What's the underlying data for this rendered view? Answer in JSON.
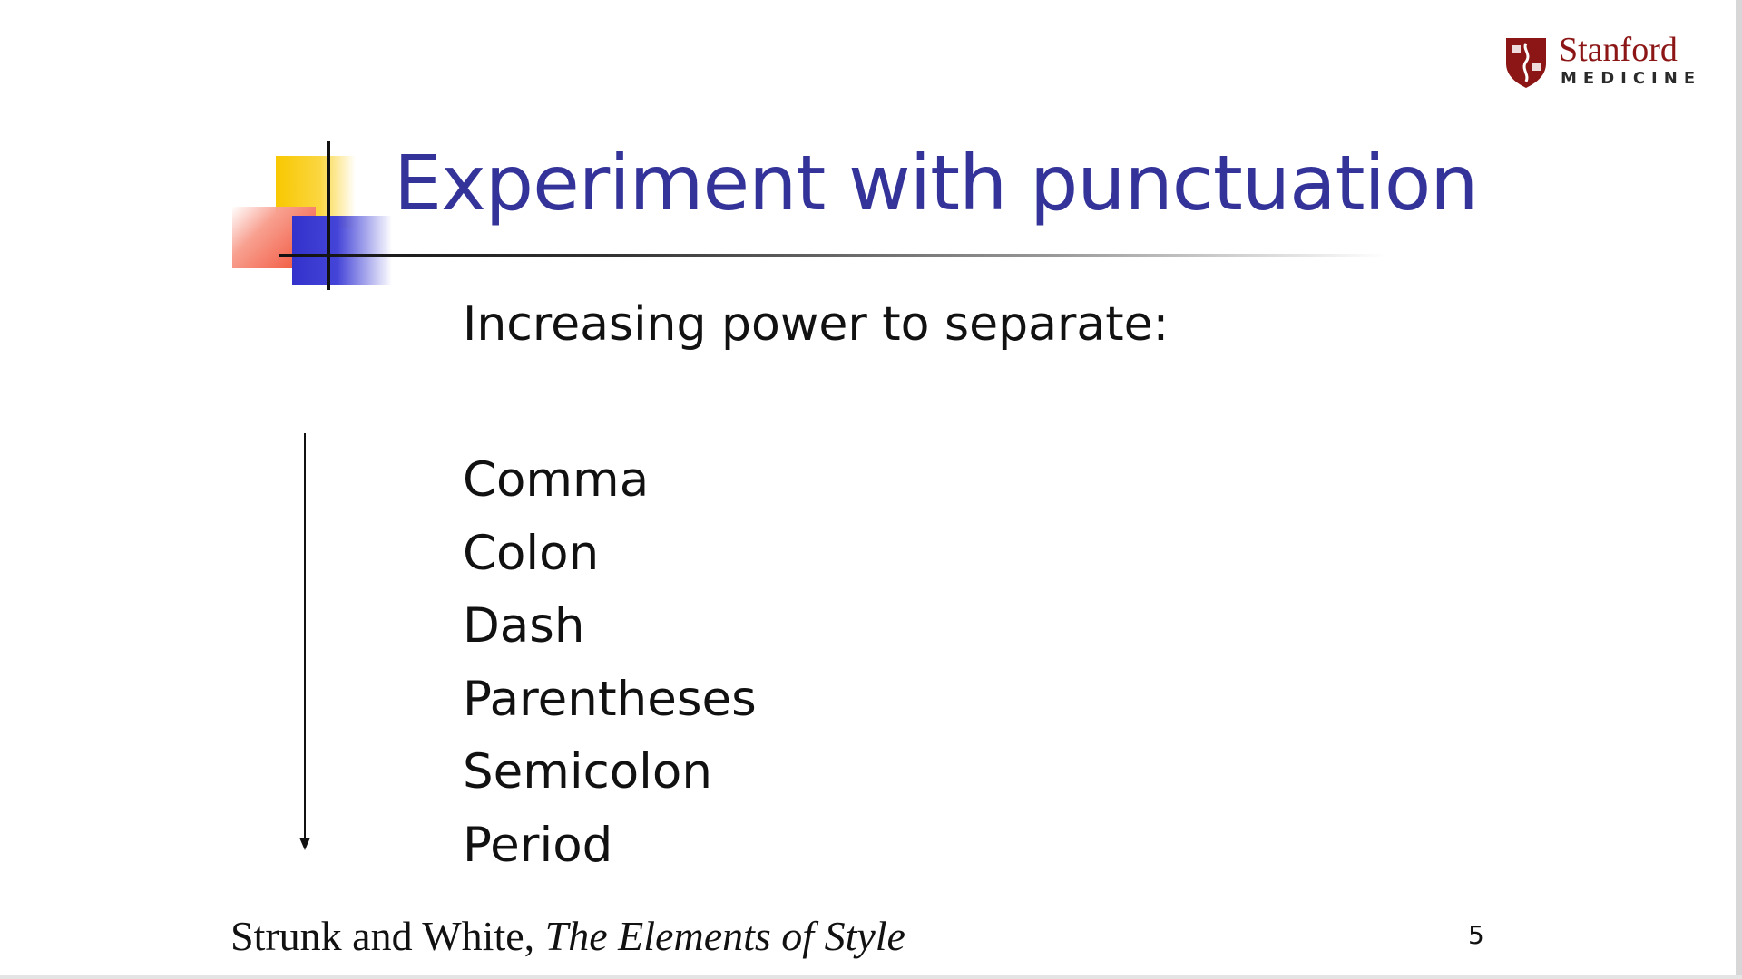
{
  "logo": {
    "wordmark": "Stanford",
    "subtitle": "MEDICINE",
    "brand_color": "#8c1515"
  },
  "slide": {
    "title": "Experiment with punctuation",
    "title_color": "#333399",
    "subtitle": "Increasing power to separate:",
    "items": [
      {
        "label": "Comma"
      },
      {
        "label": "Colon"
      },
      {
        "label": "Dash"
      },
      {
        "label": "Parentheses"
      },
      {
        "label": "Semicolon"
      },
      {
        "label": "Period"
      }
    ],
    "arrow_icon": "down-arrow-icon"
  },
  "footer": {
    "citation_authors": "Strunk and White, ",
    "citation_book": "The Elements of Style",
    "page_number": "5"
  }
}
